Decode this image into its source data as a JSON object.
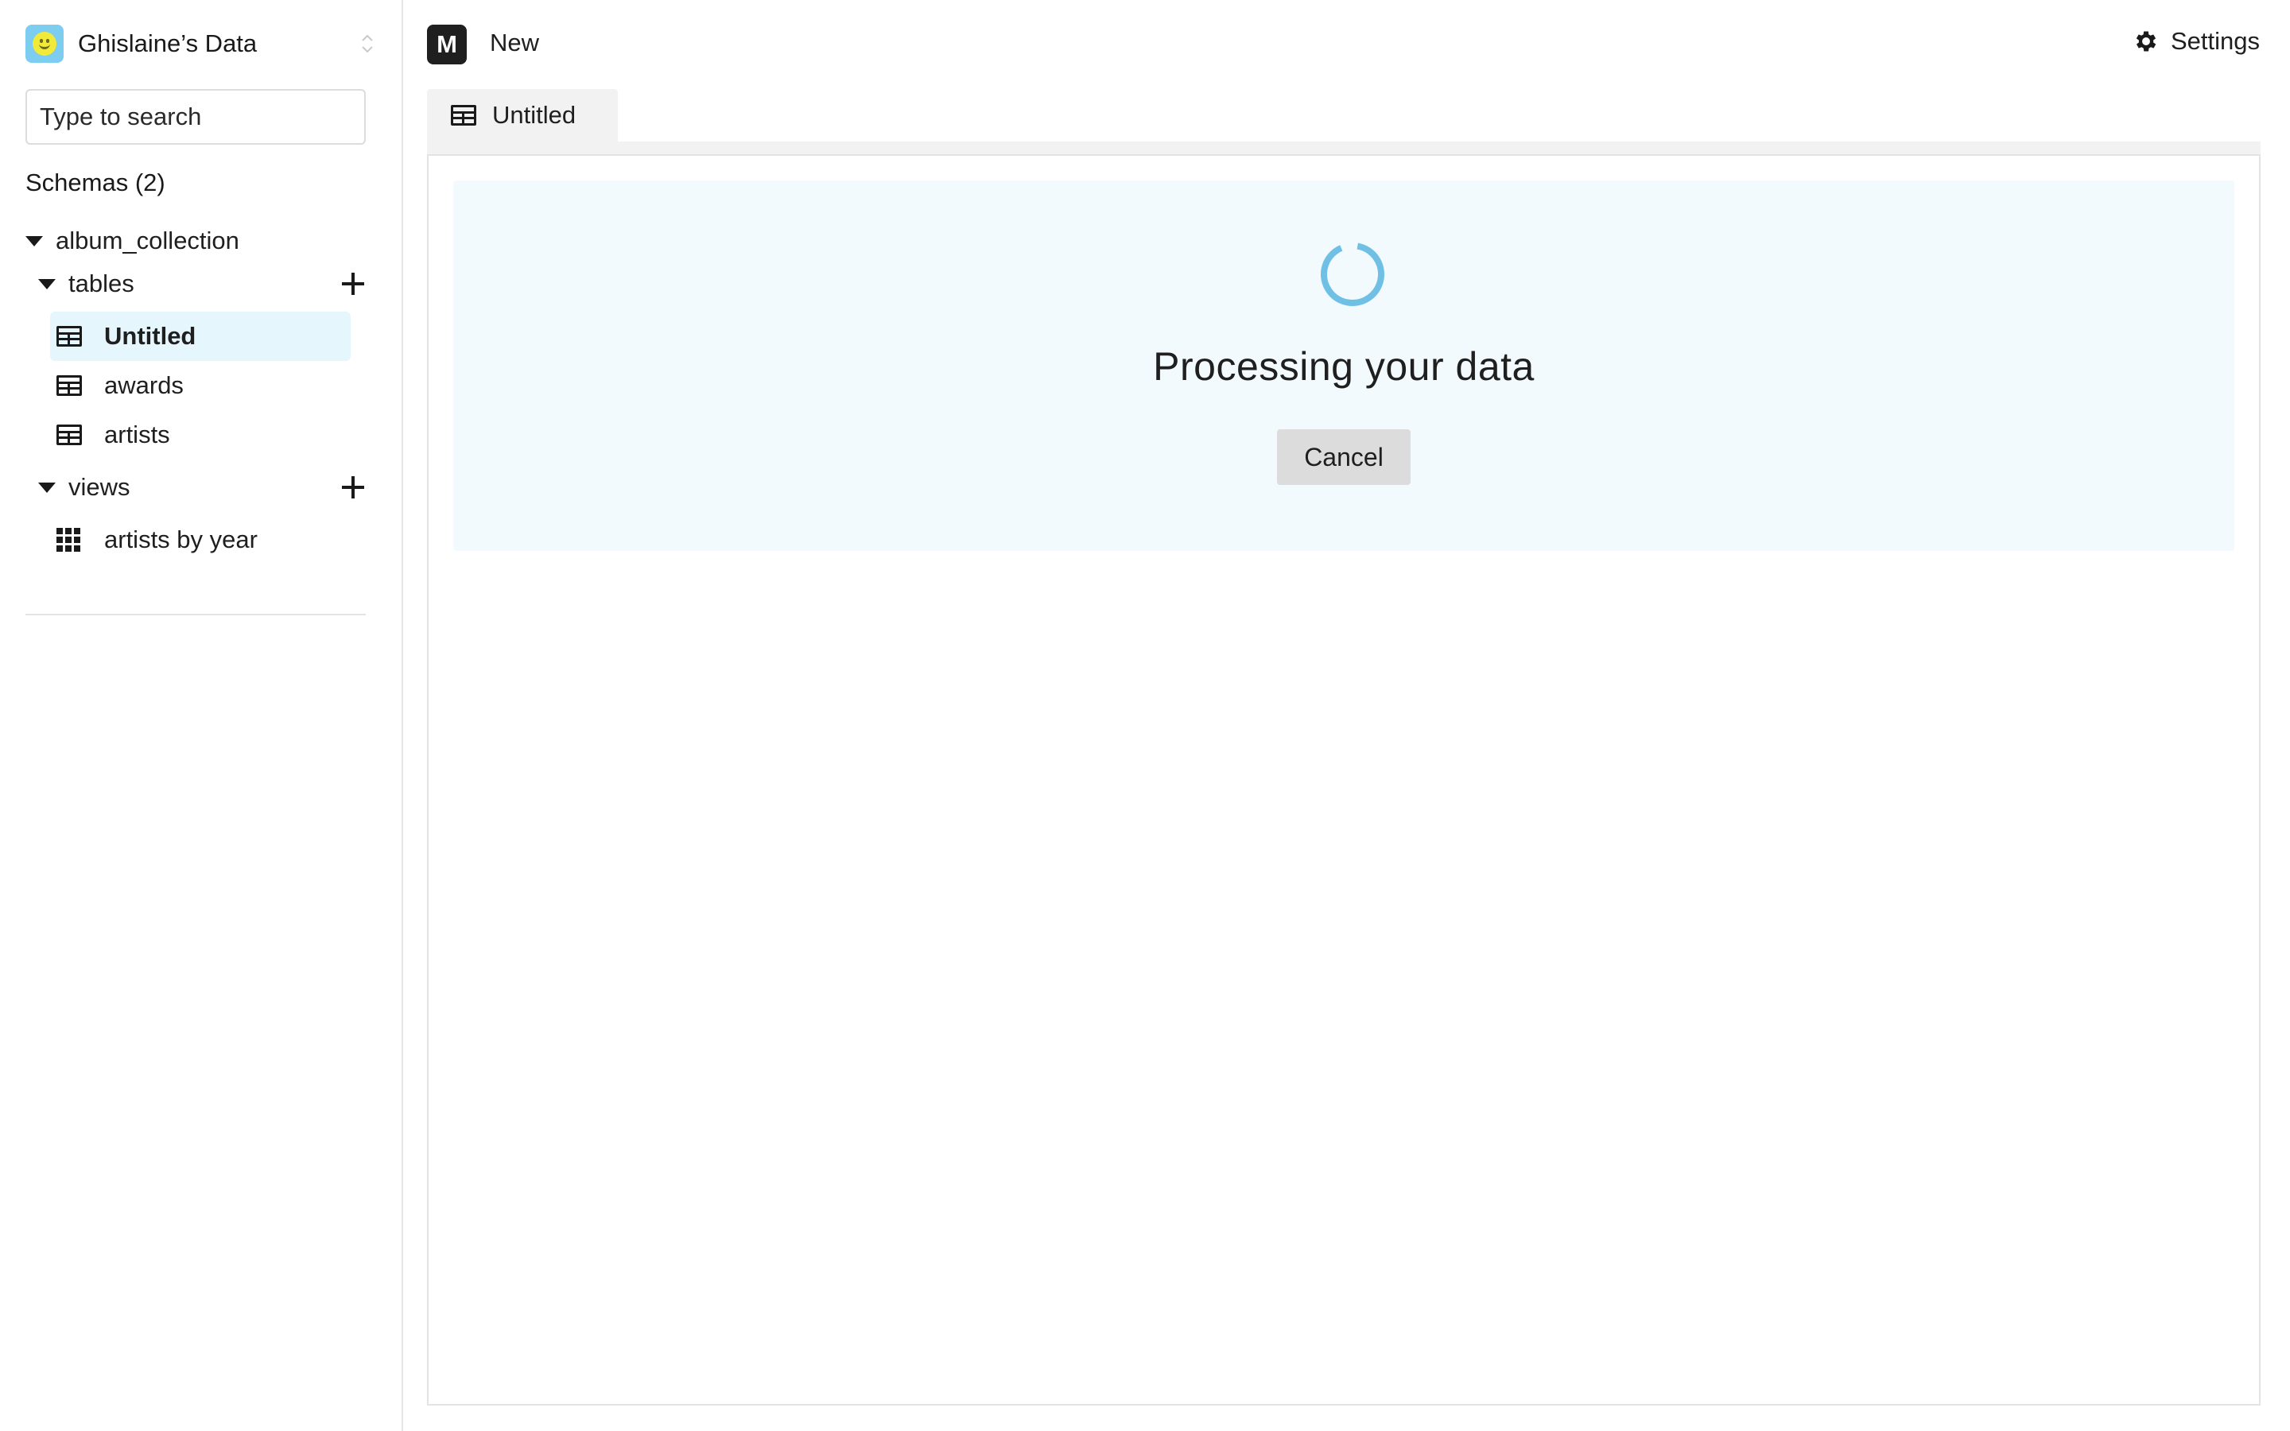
{
  "sidebar": {
    "db_name": "Ghislaine’s Data",
    "search_placeholder": "Type to search",
    "schemas_title": "Schemas (2)",
    "schema": {
      "name": "album_collection",
      "tables_label": "tables",
      "tables": [
        "Untitled",
        "awards",
        "artists"
      ],
      "active_table": "Untitled",
      "views_label": "views",
      "views": [
        "artists by year"
      ]
    }
  },
  "topbar": {
    "logo": "M",
    "new_label": "New",
    "settings_label": "Settings"
  },
  "tabs": [
    {
      "label": "Untitled"
    }
  ],
  "main": {
    "processing_title": "Processing your data",
    "cancel_label": "Cancel"
  },
  "colors": {
    "accent": "#6fc0e4",
    "active_item_bg": "#e6f6fd",
    "processing_bg": "#f2fafd"
  },
  "icons": {
    "db_avatar": "smiley-face-icon",
    "table": "table-icon",
    "view": "grid-icon",
    "settings": "gear-icon",
    "add": "plus-icon",
    "expand": "caret-down-icon",
    "switch": "chevron-updown-icon"
  }
}
